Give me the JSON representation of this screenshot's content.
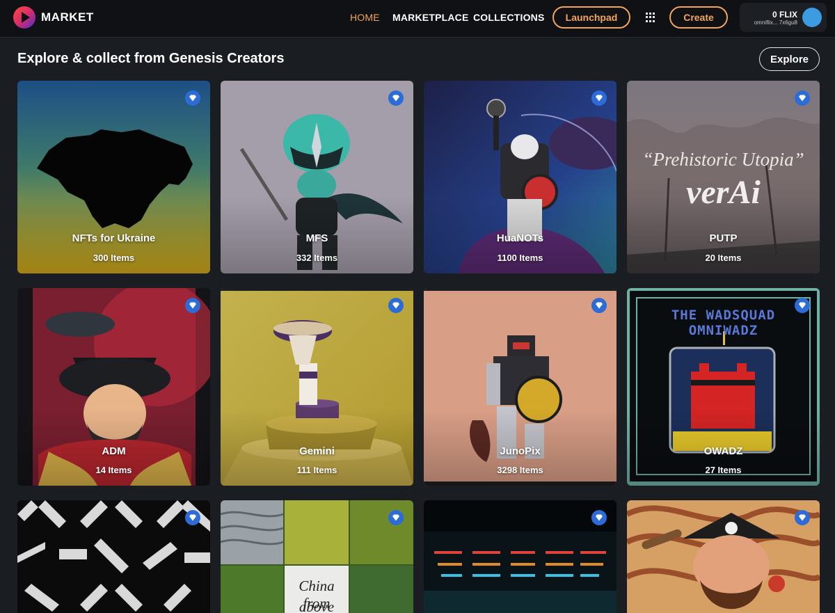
{
  "header": {
    "brand": "MARKET",
    "logo_icon": "omniflix-play-logo-icon",
    "nav": [
      "HOME",
      "MARKETPLACE",
      "COLLECTIONS"
    ],
    "active_nav": "HOME",
    "launchpad_label": "Launchpad",
    "apps_icon": "apps-grid-icon",
    "create_label": "Create",
    "wallet": {
      "balance": "0 FLIX",
      "address": "omniflix... 7x6gu8"
    }
  },
  "section": {
    "title": "Explore & collect from Genesis Creators",
    "explore_label": "Explore"
  },
  "collections": [
    {
      "name": "NFTs for Ukraine",
      "count": "300 Items",
      "verified_icon": "verified-badge-icon"
    },
    {
      "name": "MFS",
      "count": "332 Items",
      "verified_icon": "verified-badge-icon"
    },
    {
      "name": "HuaNOTs",
      "count": "1100 Items",
      "verified_icon": "verified-badge-icon"
    },
    {
      "name": "PUTP",
      "count": "20 Items",
      "verified_icon": "verified-badge-icon",
      "art_text": [
        "“Prehistoric Utopia”",
        "verAi"
      ]
    },
    {
      "name": "ADM",
      "count": "14 Items",
      "verified_icon": "verified-badge-icon"
    },
    {
      "name": "Gemini",
      "count": "111 Items",
      "verified_icon": "verified-badge-icon"
    },
    {
      "name": "JunoPix",
      "count": "3298 Items",
      "verified_icon": "verified-badge-icon"
    },
    {
      "name": "OWADZ",
      "count": "27 Items",
      "verified_icon": "verified-badge-icon",
      "art_text": [
        "THE WADSQUAD",
        "OMNIWADZ"
      ]
    },
    {
      "name": "",
      "count": "",
      "verified_icon": "verified-badge-icon"
    },
    {
      "name": "",
      "count": "",
      "verified_icon": "verified-badge-icon",
      "art_text": [
        "China from",
        "above"
      ]
    },
    {
      "name": "",
      "count": "",
      "verified_icon": "verified-badge-icon"
    },
    {
      "name": "",
      "count": "",
      "verified_icon": "verified-badge-icon"
    }
  ],
  "colors": {
    "accent": "#f3a55b",
    "background": "#1a1d21",
    "header": "#0f1114",
    "verified": "#2d6bd6",
    "avatar": "#3b9ce2"
  }
}
